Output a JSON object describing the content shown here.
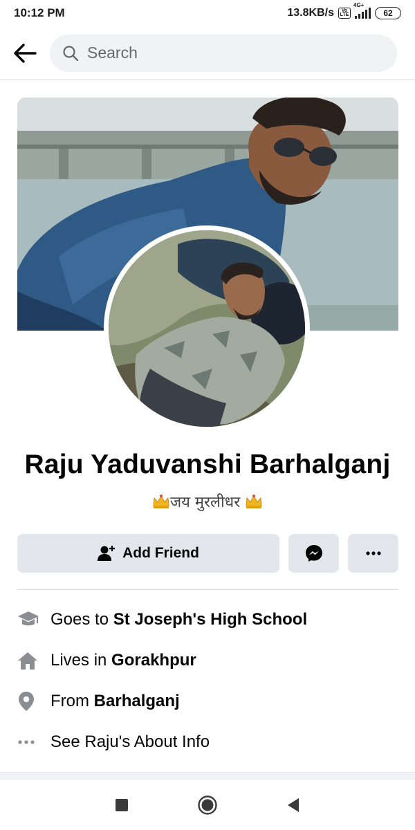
{
  "status_bar": {
    "time": "10:12 PM",
    "speed": "13.8KB/s",
    "network": "4G+",
    "battery": "62"
  },
  "search": {
    "placeholder": "Search"
  },
  "profile": {
    "name": "Raju Yaduvanshi Barhalganj",
    "bio": "जय मुरलीधर"
  },
  "actions": {
    "add_friend_label": "Add Friend"
  },
  "info": {
    "school_prefix": "Goes to ",
    "school": "St Joseph's High School",
    "lives_prefix": "Lives in ",
    "lives": "Gorakhpur",
    "from_prefix": "From ",
    "from": "Barhalganj",
    "about_label": "See Raju's About Info"
  },
  "icons": {
    "back": "arrow-left-icon",
    "search": "search-icon",
    "add_friend": "person-plus-icon",
    "messenger": "messenger-icon",
    "more": "more-dots-icon",
    "school": "graduation-cap-icon",
    "home": "home-icon",
    "location": "location-pin-icon",
    "crown": "crown-icon"
  },
  "colors": {
    "button_bg": "#e4e6eb",
    "search_bg": "#f0f2f5",
    "icon_gray": "#8a8d91",
    "text": "#050505"
  }
}
